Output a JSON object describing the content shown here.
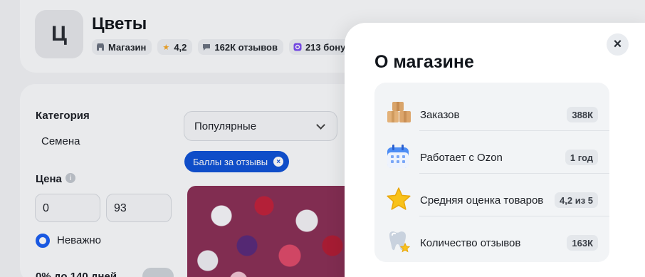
{
  "store": {
    "avatar_letter": "Ц",
    "title": "Цветы",
    "chips": [
      {
        "icon": "shop-icon",
        "label": "Магазин"
      },
      {
        "icon": "star-icon",
        "label": "4,2"
      },
      {
        "icon": "chat-icon",
        "label": "162К отзывов"
      },
      {
        "icon": "bonus-icon",
        "label": "213 бону"
      }
    ]
  },
  "filters": {
    "category_label": "Категория",
    "category_value": "Семена",
    "price_label": "Цена",
    "price_from": "0",
    "price_to": "93",
    "radio_label": "Неважно",
    "installment_label": "0% до 140 дней"
  },
  "listing": {
    "sort_value": "Популярные",
    "active_tag": "Баллы за отзывы"
  },
  "modal": {
    "title": "О магазине",
    "rows": [
      {
        "icon": "boxes-icon",
        "label": "Заказов",
        "value": "388К"
      },
      {
        "icon": "calendar-icon",
        "label": "Работает с Ozon",
        "value": "1 год"
      },
      {
        "icon": "star-icon",
        "label": "Средняя оценка товаров",
        "value": "4,2 из 5"
      },
      {
        "icon": "tooth-star-icon",
        "label": "Количество отзывов",
        "value": "163К"
      }
    ]
  }
}
